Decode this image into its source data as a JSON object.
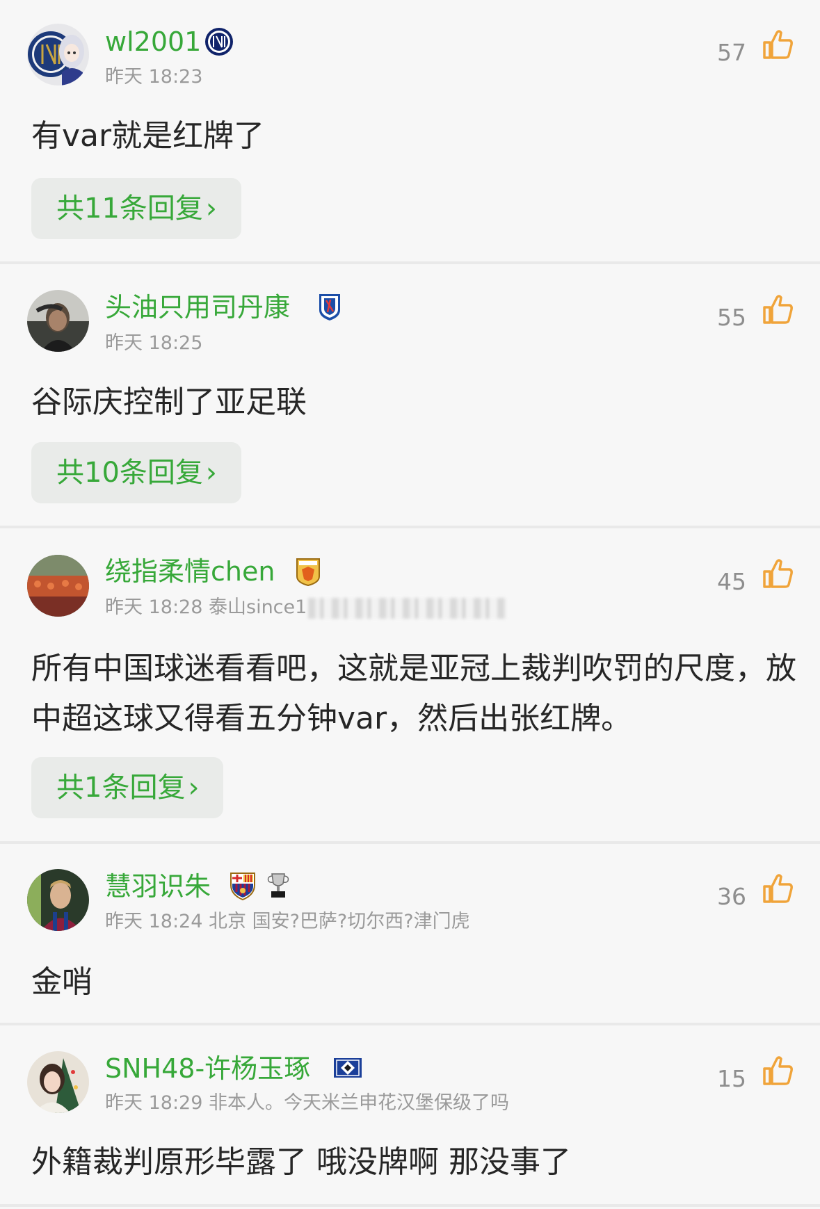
{
  "colors": {
    "username": "#37a839",
    "meta": "#9a9a9a",
    "like_icon": "#f0a43a",
    "reply_bg": "#e9ebe9",
    "divider": "#e9e9e9"
  },
  "comments": [
    {
      "username": "wl2001",
      "badges": [
        "inter-milan-badge"
      ],
      "time": "昨天 18:23",
      "extra": "",
      "likes": "57",
      "text": "有var就是红牌了",
      "replies": "共11条回复",
      "reply_chevron": "›"
    },
    {
      "username": "头油只用司丹康",
      "badges": [
        "shanghai-shenhua-badge"
      ],
      "time": "昨天 18:25",
      "extra": "",
      "likes": "55",
      "text": "谷际庆控制了亚足联",
      "replies": "共10条回复",
      "reply_chevron": "›"
    },
    {
      "username": "绕指柔情chen",
      "badges": [
        "shandong-taishan-badge"
      ],
      "time": "昨天 18:28",
      "extra": "泰山since1",
      "likes": "45",
      "text": "所有中国球迷看看吧，这就是亚冠上裁判吹罚的尺度，放中超这球又得看五分钟var，然后出张红牌。",
      "replies": "共1条回复",
      "reply_chevron": "›"
    },
    {
      "username": "慧羽识朱",
      "badges": [
        "barcelona-badge",
        "trophy-badge"
      ],
      "time": "昨天 18:24",
      "extra": "北京 国安?巴萨?切尔西?津门虎",
      "likes": "36",
      "text": "金哨"
    },
    {
      "username": "SNH48-许杨玉琢",
      "badges": [
        "hamburg-badge"
      ],
      "time": "昨天 18:29",
      "extra": "非本人。今天米兰申花汉堡保级了吗",
      "likes": "15",
      "text": "外籍裁判原形毕露了 哦没牌啊 那没事了"
    }
  ]
}
